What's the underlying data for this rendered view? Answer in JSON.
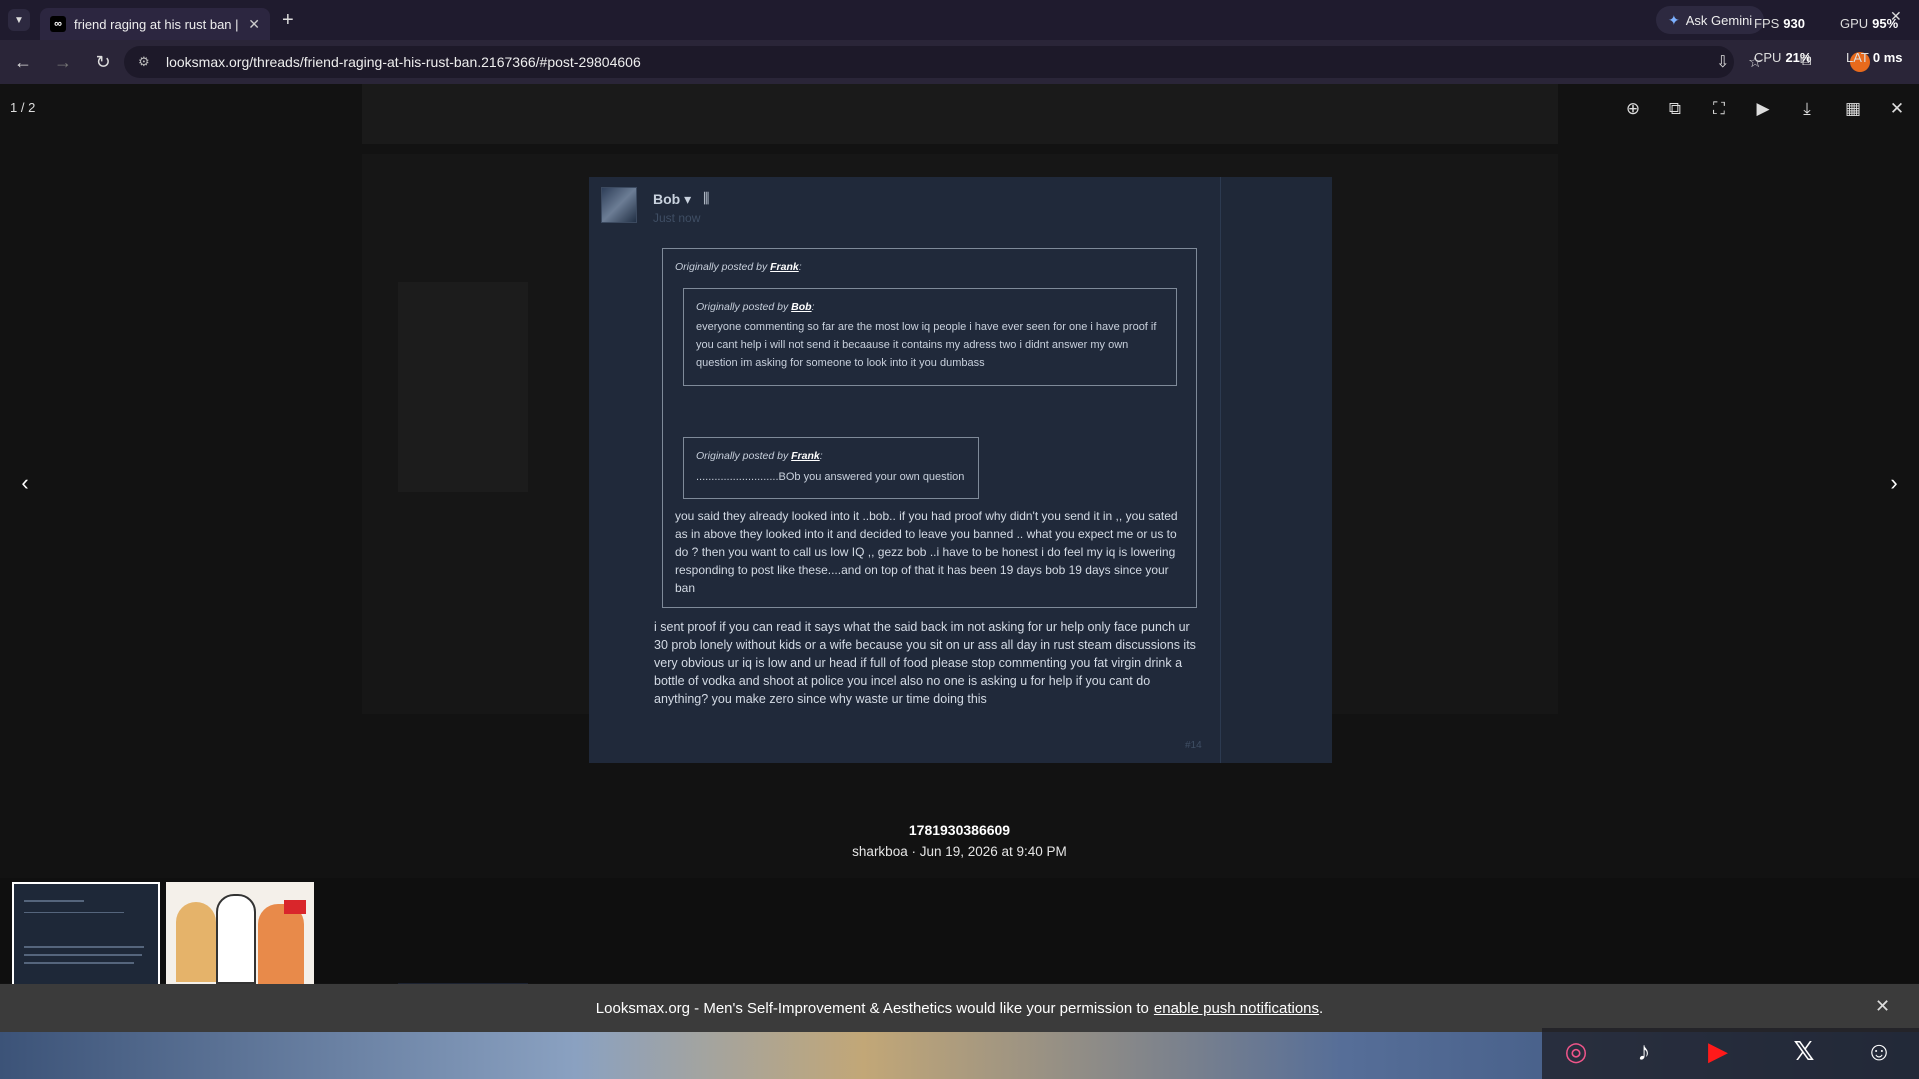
{
  "browser": {
    "tab_title": "friend raging at his rust ban | Lo",
    "tab_close": "✕",
    "new_tab": "+",
    "ask_gemini": "Ask Gemini",
    "url": "looksmax.org/threads/friend-raging-at-his-rust-ban.2167366/#post-29804606",
    "perf": {
      "fps_label": "FPS",
      "fps_value": "930",
      "gpu_label": "GPU",
      "gpu_value": "95%",
      "cpu_label": "CPU",
      "cpu_value": "21%",
      "lat_label": "LAT",
      "lat_value": "0 ms"
    }
  },
  "lightbox": {
    "counter": "1 / 2",
    "caption_title": "1781930386609",
    "caption_sub": "sharkboa · Jun 19, 2026 at 9:40 PM"
  },
  "post": {
    "author": "Bob",
    "time": "Just now",
    "outer_quote": {
      "prefix": "Originally posted by ",
      "author": "Frank",
      "suffix": ":"
    },
    "inner_quote1": {
      "prefix": "Originally posted by ",
      "author": "Bob",
      "suffix": ":",
      "text": "everyone commenting so far are the most low iq people i have ever seen for one i have proof if you cant help i will not send it becaause it contains my adress two i didnt answer my own question im asking for someone to look into it you dumbass"
    },
    "inner_quote2": {
      "prefix": "Originally posted by ",
      "author": "Frank",
      "suffix": ":",
      "text": "...........................BOb you answered your own question"
    },
    "quote_reply": "you said they already looked into it ..bob.. if you had proof why didn't you send it in ,, you sated as in above they looked into it and decided to leave you banned .. what you expect me or us to do ? then you want to call us low IQ ,, gezz bob ..i have to be honest i do feel my iq is lowering responding to post like these....and on top of that it has been 19 days bob 19 days since your ban",
    "reply": "i sent proof if you can read it says what the said back im not asking for ur help only face punch ur 30 prob lonely without kids or a wife because you sit on ur ass all day in rust steam discussions its very obvious ur iq is low and ur head if full of food please stop commenting you fat virgin drink a bottle of vodka and shoot at police you incel also no one is asking u for help if you cant do anything? you make zero since why waste ur time doing this",
    "number": "#14"
  },
  "notification": {
    "text": "Looksmax.org - Men's Self-Improvement & Aesthetics would like your permission to",
    "link": "enable push notifications",
    "suffix": "."
  }
}
